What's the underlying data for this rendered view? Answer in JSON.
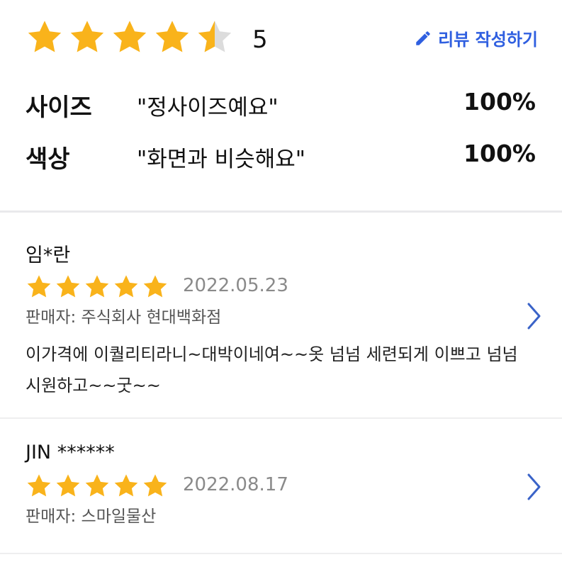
{
  "summary": {
    "rating": "5",
    "stars_filled": 4.5,
    "stars_max": 5,
    "write_review_label": "리뷰 작성하기",
    "accent_color": "#2f5fe0",
    "star_color": "#f9b31b",
    "attributes": [
      {
        "name": "사이즈",
        "value": "\"정사이즈예요\"",
        "percent": "100%"
      },
      {
        "name": "색상",
        "value": "\"화면과 비슷해요\"",
        "percent": "100%"
      }
    ]
  },
  "reviews": [
    {
      "reviewer": "임*란",
      "stars": 5,
      "date": "2022.05.23",
      "seller": "판매자: 주식회사 현대백화점",
      "text": "이가격에 이퀄리티라니~대박이네여~~옷 넘넘 세련되게 이쁘고 넘넘 시원하고~~굿~~"
    },
    {
      "reviewer": "JIN ******",
      "stars": 5,
      "date": "2022.08.17",
      "seller": "판매자: 스마일물산"
    }
  ],
  "icons": {
    "star": "star-icon",
    "edit": "pencil-icon",
    "chevron": "chevron-right-icon"
  }
}
